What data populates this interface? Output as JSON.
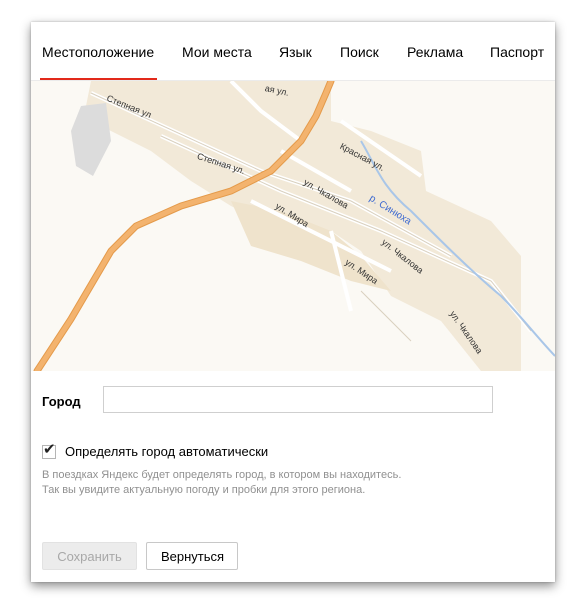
{
  "tabs": [
    {
      "label": "Местоположение",
      "active": true
    },
    {
      "label": "Мои места"
    },
    {
      "label": "Язык"
    },
    {
      "label": "Поиск"
    },
    {
      "label": "Реклама"
    },
    {
      "label": "Паспорт"
    }
  ],
  "map": {
    "streets": {
      "stepnaya_1": "Степная ул",
      "stepnaya_2": "Степная ул.",
      "krasnaya": "Красная ул.",
      "top_cut": "ая ул.",
      "chkalova_1": "ул. Чкалова",
      "chkalova_2": "ул. Чкалова",
      "chkalova_3": "ул. Чкалова",
      "mira_1": "ул. Мира",
      "mira_2": "ул. Мира"
    },
    "river": "р. Синюха",
    "colors": {
      "road": "#f3b36e",
      "built_up": "#f2e9d8",
      "background": "#fbf9f4",
      "building": "#dcdcdc"
    }
  },
  "form": {
    "city_label": "Город",
    "city_value": "",
    "auto_label": "Определять город автоматически",
    "auto_checked": true,
    "check_glyph": "✔",
    "hint_line1": "В поездках Яндекс будет определять город, в котором вы находитесь.",
    "hint_line2": "Так вы увидите актуальную погоду и пробки для этого региона."
  },
  "buttons": {
    "save": "Сохранить",
    "back": "Вернуться"
  },
  "accent_color": "#e2291a"
}
